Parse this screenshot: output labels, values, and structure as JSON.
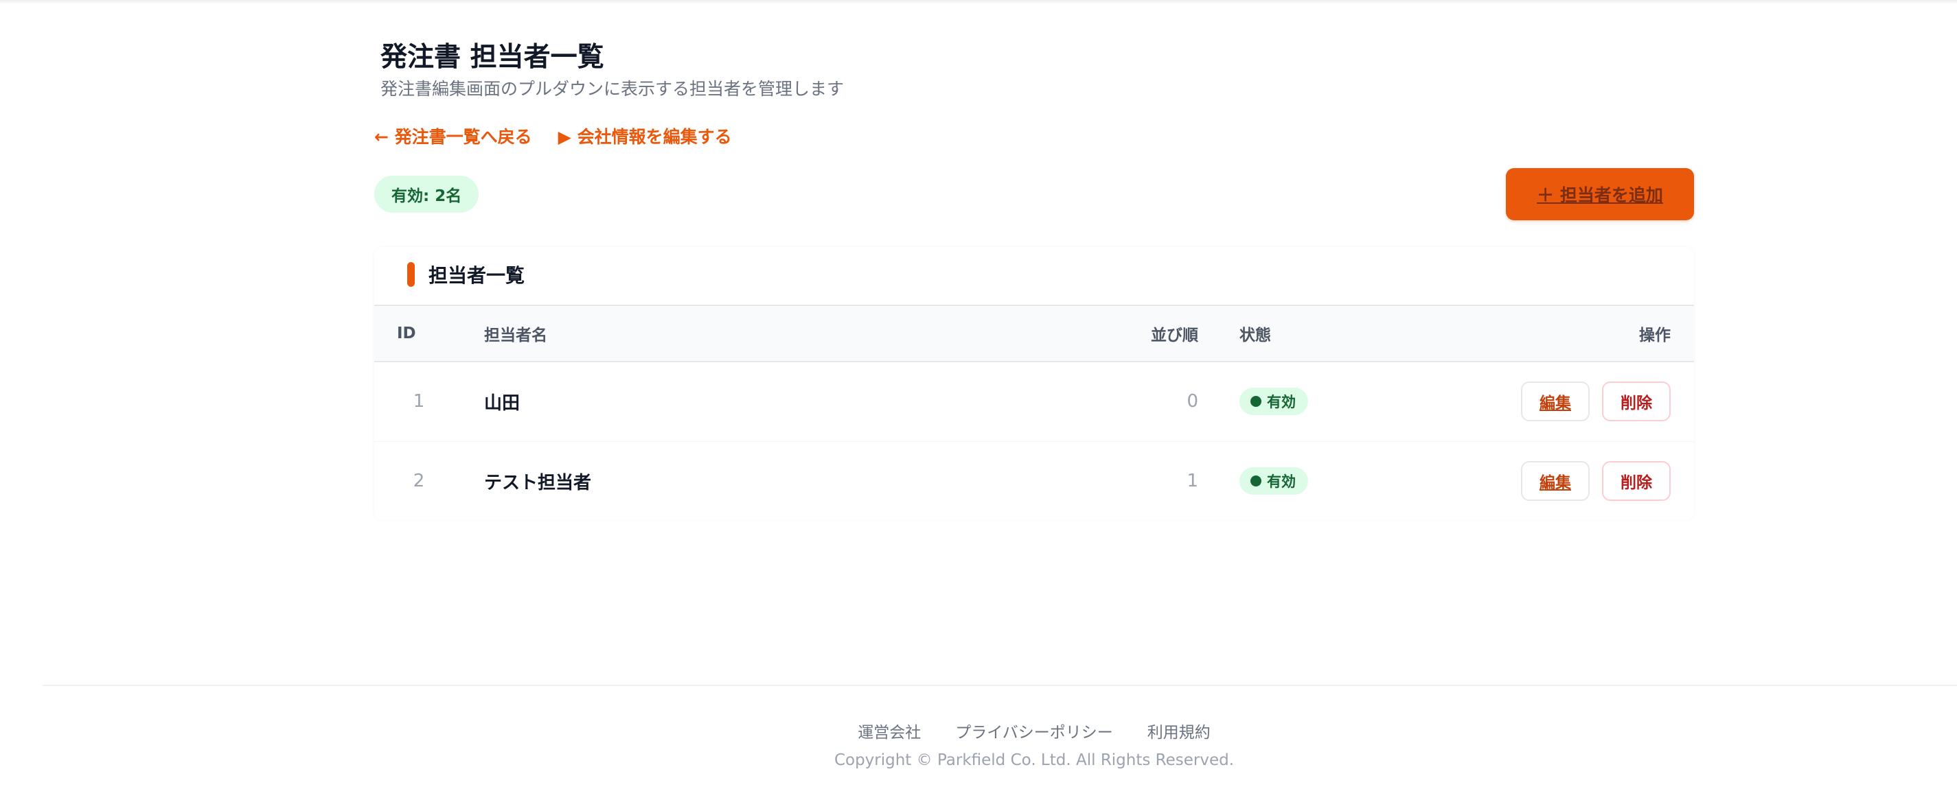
{
  "page": {
    "title": "発注書 担当者一覧",
    "subtitle": "発注書編集画面のプルダウンに表示する担当者を管理します"
  },
  "nav": {
    "back_label": "← 発注書一覧へ戻る",
    "company_label": "▶ 会社情報を編集する"
  },
  "summary": {
    "active_count_label": "有効: 2名"
  },
  "toolbar": {
    "add_label": "＋ 担当者を追加"
  },
  "list": {
    "title": "担当者一覧",
    "columns": {
      "id": "ID",
      "name": "担当者名",
      "order": "並び順",
      "status": "状態",
      "actions": "操作"
    },
    "rows": [
      {
        "id": "1",
        "name": "山田",
        "order": "0",
        "status": "有効",
        "edit_label": "編集",
        "delete_label": "削除"
      },
      {
        "id": "2",
        "name": "テスト担当者",
        "order": "1",
        "status": "有効",
        "edit_label": "編集",
        "delete_label": "削除"
      }
    ]
  },
  "footer": {
    "links": [
      "運営会社",
      "プライバシーポリシー",
      "利用規約"
    ],
    "copyright": "Copyright © Parkfield Co. Ltd. All Rights Reserved."
  },
  "colors": {
    "accent": "#ea580c",
    "status_active_bg": "#dcfce7",
    "status_active_text": "#166534",
    "delete_text": "#b91c1c"
  }
}
